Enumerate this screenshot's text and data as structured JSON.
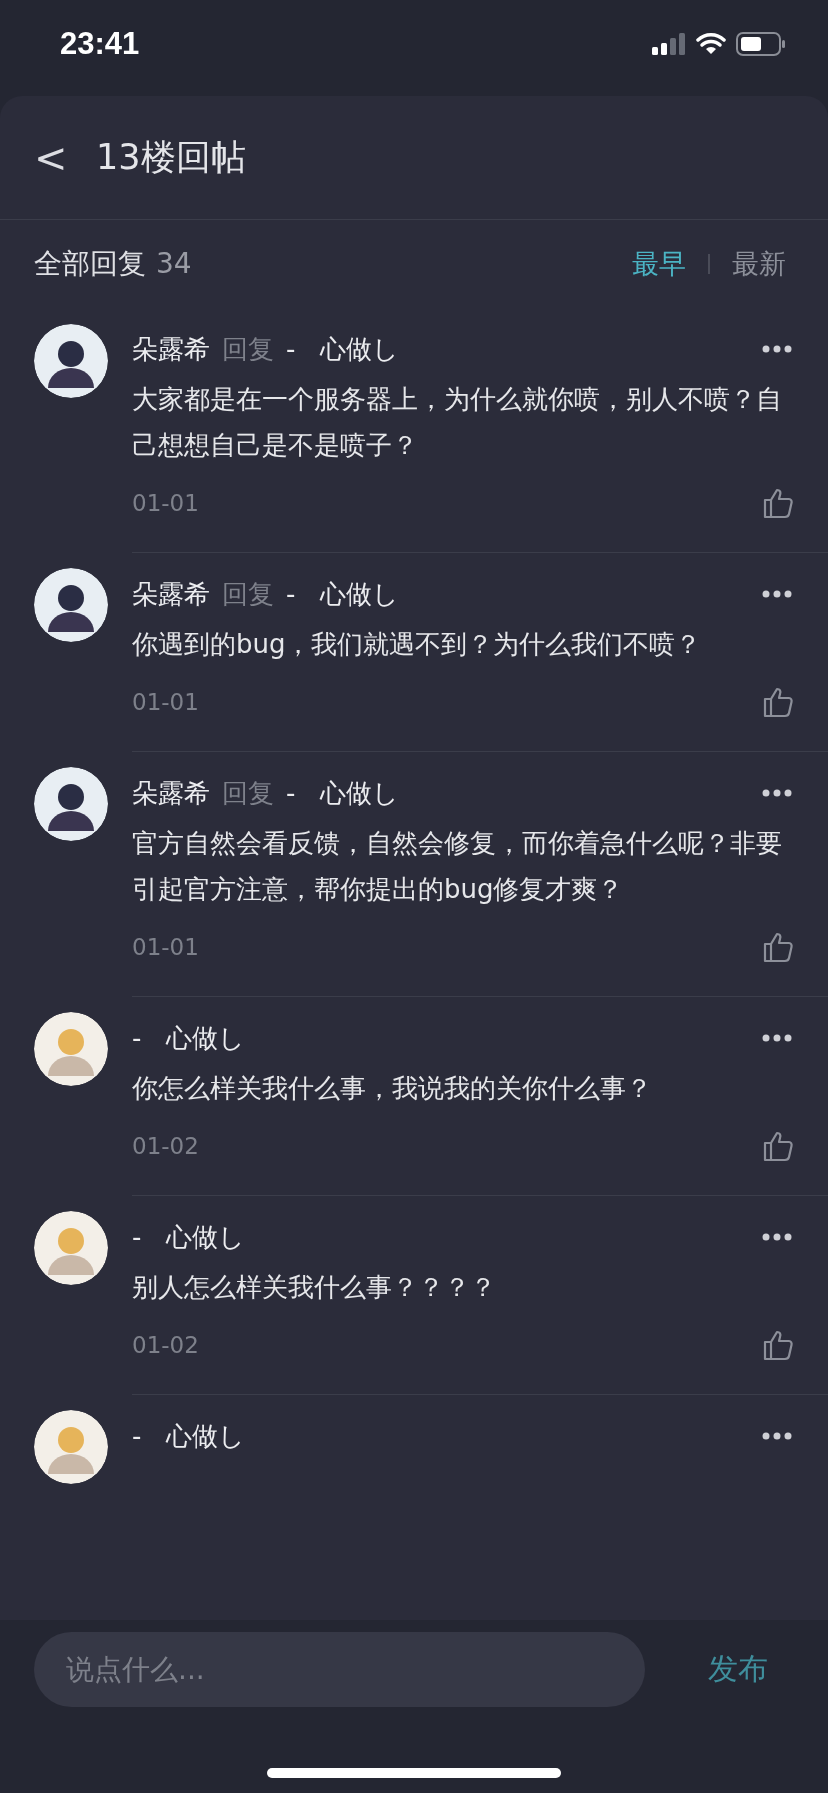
{
  "status_bar": {
    "time": "23:41"
  },
  "header": {
    "back": "<",
    "title": "13楼回帖"
  },
  "summary": {
    "label": "全部回复",
    "count": "34"
  },
  "sort_options": [
    {
      "label": "最早",
      "selected": true
    },
    {
      "label": "最新",
      "selected": false
    }
  ],
  "comments": [
    {
      "author": "朵露希",
      "reply_label": "回复",
      "reply_to": "-   心做し",
      "text": "大家都是在一个服务器上，为什么就你喷，别人不喷？自己想想自己是不是喷子？",
      "date": "01-01",
      "liked": false
    },
    {
      "author": "朵露希",
      "reply_label": "回复",
      "reply_to": "-   心做し",
      "text": "你遇到的bug，我们就遇不到？为什么我们不喷？",
      "date": "01-01",
      "liked": false
    },
    {
      "author": "朵露希",
      "reply_label": "回复",
      "reply_to": "-   心做し",
      "text": "官方自然会看反馈，自然会修复，而你着急什么呢？非要引起官方注意，帮你提出的bug修复才爽？",
      "date": "01-01",
      "liked": false
    },
    {
      "author": "-   心做し",
      "text": "你怎么样关我什么事，我说我的关你什么事？",
      "date": "01-02",
      "liked": false
    },
    {
      "author": "-   心做し",
      "text": "别人怎么样关我什么事？？？？",
      "date": "01-02",
      "liked": false
    },
    {
      "author": "-   心做し"
    }
  ],
  "composer": {
    "placeholder": "说点什么...",
    "send": "发布"
  }
}
